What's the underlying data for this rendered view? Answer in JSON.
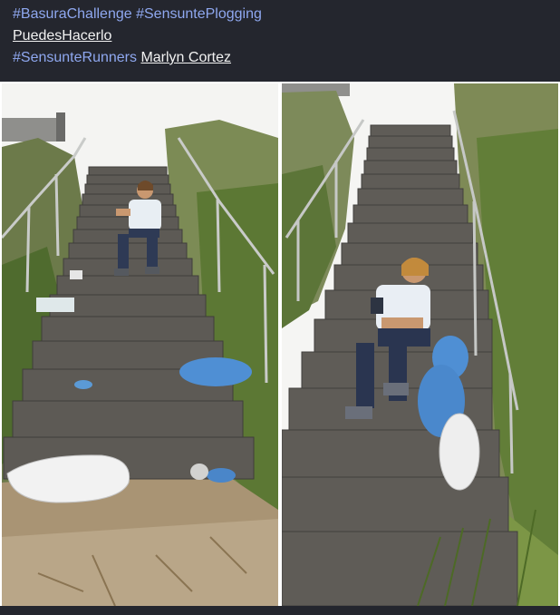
{
  "post": {
    "caption": {
      "line1": {
        "hashtag1": "#BasuraChallenge",
        "hashtag2": "#SensuntePlogging"
      },
      "line2": {
        "mention": "PuedesHacerlo"
      },
      "line3": {
        "hashtag": "#SensunteRunners",
        "mention": "Marlyn Cortez"
      }
    }
  },
  "colors": {
    "background": "#24262e",
    "hashtag": "#8fa8f0",
    "mention": "#f2f2f2"
  },
  "photos": [
    {
      "icon": "photo-before-cleanup"
    },
    {
      "icon": "photo-after-cleanup"
    }
  ]
}
